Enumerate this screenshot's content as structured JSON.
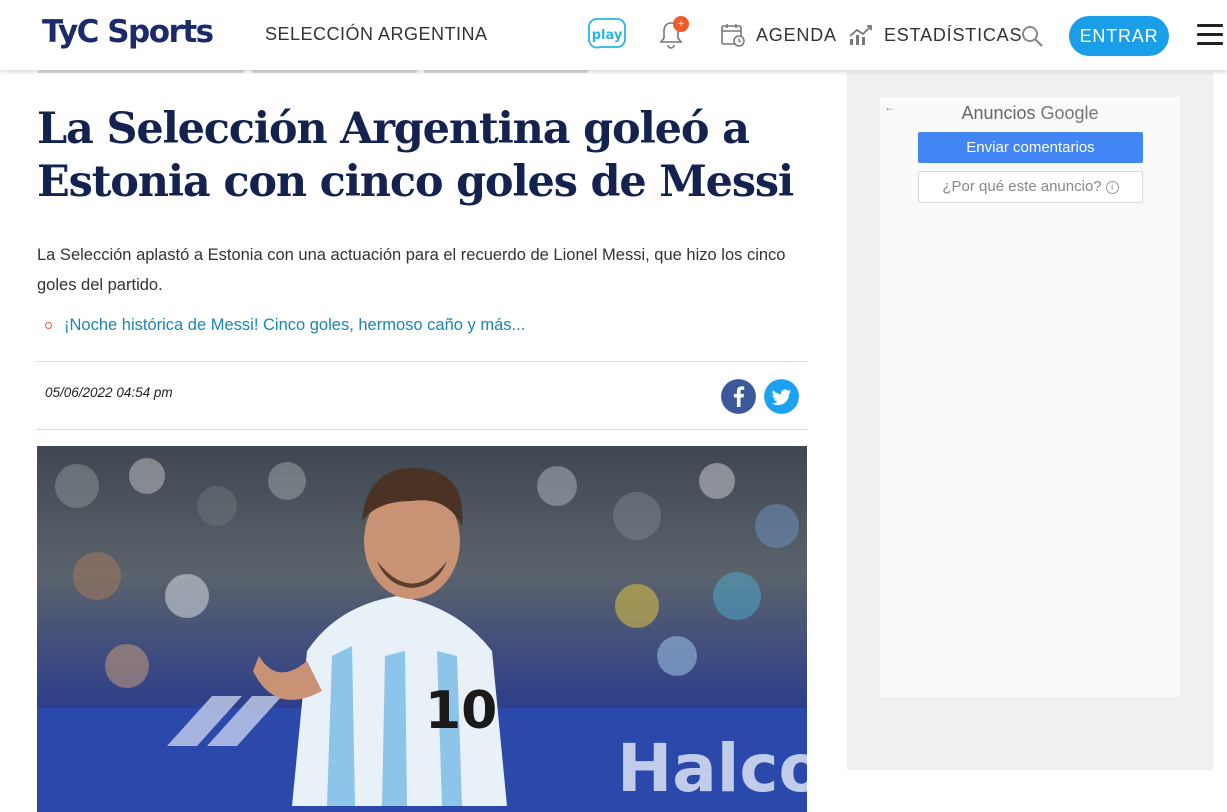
{
  "header": {
    "logo_text": "TyC Sports",
    "section_label": "SELECCIÓN ARGENTINA",
    "play_label": "play",
    "notification_badge": "+",
    "agenda_label": "AGENDA",
    "stats_label": "ESTADÍSTICAS",
    "login_label": "ENTRAR",
    "icons": [
      "play-icon",
      "bell-icon",
      "calendar-icon",
      "chart-icon",
      "search-icon",
      "menu-icon"
    ]
  },
  "article": {
    "title": "La Selección Argentina goleó a Estonia con cinco goles de Messi",
    "summary": "La Selección aplastó a Estonia con una actuación para el recuerdo de Lionel Messi, que hizo los cinco goles del partido.",
    "related_link": "¡Noche histórica de Messi! Cinco goles, hermoso caño y más...",
    "date": "05/06/2022 04:54 pm",
    "share": [
      "facebook-icon",
      "twitter-icon"
    ]
  },
  "ad": {
    "header_prefix": "Anuncios",
    "header_brand": "Google",
    "feedback_button": "Enviar comentarios",
    "why_button": "¿Por qué este anuncio?",
    "back_arrow": "←",
    "info_glyph": "i"
  },
  "colors": {
    "brand_navy": "#14224f",
    "accent_blue": "#1a9ee8",
    "link_blue": "#1787b7",
    "accent_orange": "#f05a28",
    "google_blue": "#4285f4",
    "facebook_blue": "#3b5998",
    "twitter_blue": "#1da1f2"
  }
}
